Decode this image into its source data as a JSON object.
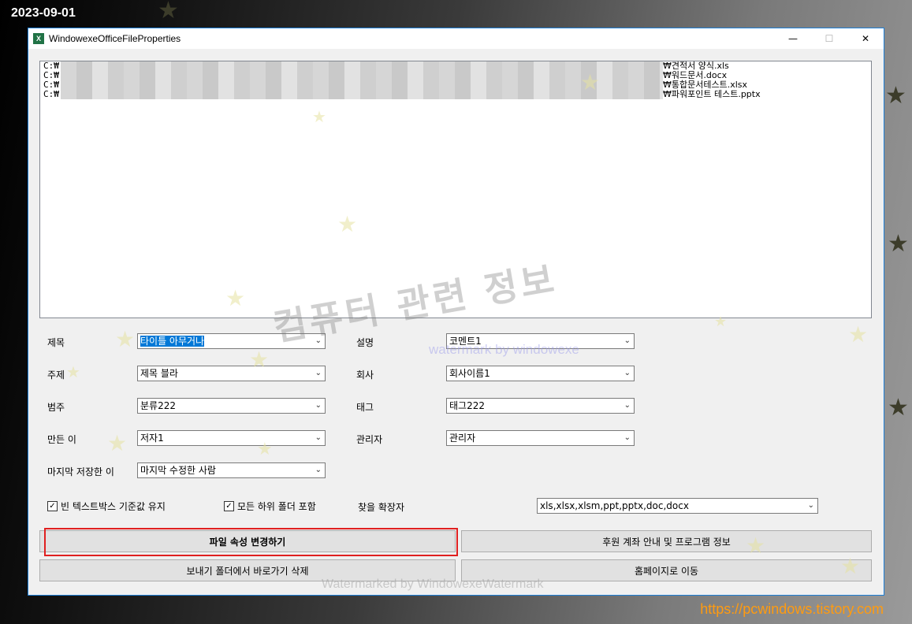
{
  "overlay": {
    "date": "2023-09-01",
    "site_url": "https://pcwindows.tistory.com"
  },
  "window": {
    "title": "WindowexeOfficeFileProperties",
    "app_icon": "excel-icon",
    "icon_text": "X",
    "minimize_glyph": "—",
    "maximize_glyph": "☐",
    "close_glyph": "✕"
  },
  "file_list": [
    {
      "prefix": "C:₩",
      "suffix": "₩견적서 양식.xls"
    },
    {
      "prefix": "C:₩",
      "suffix": "₩워드문서.docx"
    },
    {
      "prefix": "C:₩",
      "suffix": "₩통합문서테스트.xlsx"
    },
    {
      "prefix": "C:₩",
      "suffix": "₩파워포인트 테스트.pptx"
    }
  ],
  "fields": {
    "title": {
      "label": "제목",
      "value": "타이틀 아무거나"
    },
    "subject": {
      "label": "주제",
      "value": "제목 블라"
    },
    "category": {
      "label": "범주",
      "value": "분류222"
    },
    "author": {
      "label": "만든 이",
      "value": "저자1"
    },
    "last_saved_by": {
      "label": "마지막 저장한 이",
      "value": "마지막 수정한 사람"
    },
    "comments": {
      "label": "설명",
      "value": "코멘트1"
    },
    "company": {
      "label": "회사",
      "value": "회사이름1"
    },
    "tags": {
      "label": "태그",
      "value": "태그222"
    },
    "manager": {
      "label": "관리자",
      "value": "관리자"
    }
  },
  "options": {
    "keep_empty_textbox_default": {
      "label": "빈 텍스트박스 기준값 유지",
      "checked": true,
      "check_glyph": "✓"
    },
    "include_subfolders": {
      "label": "모든 하위 폴더 포함",
      "checked": true,
      "check_glyph": "✓"
    },
    "extensions": {
      "label": "찾을 확장자",
      "value": "xls,xlsx,xlsm,ppt,pptx,doc,docx"
    }
  },
  "buttons": {
    "change_properties": "파일 속성 변경하기",
    "donation_info": "후원 계좌 안내 및 프로그램 정보",
    "delete_sendto_shortcut": "보내기 폴더에서 바로가기 삭제",
    "homepage": "홈페이지로 이동"
  },
  "watermarks": {
    "main": "컴퓨터 관련 정보",
    "sub": "watermark by windowexe",
    "bottom": "Watermarked by WindowexeWatermark"
  },
  "combo_arrow_glyph": "⌄",
  "star_glyph": "★",
  "colors": {
    "accent": "#0078d7",
    "highlight_border": "#e02020",
    "url_color": "#ff9b10"
  }
}
